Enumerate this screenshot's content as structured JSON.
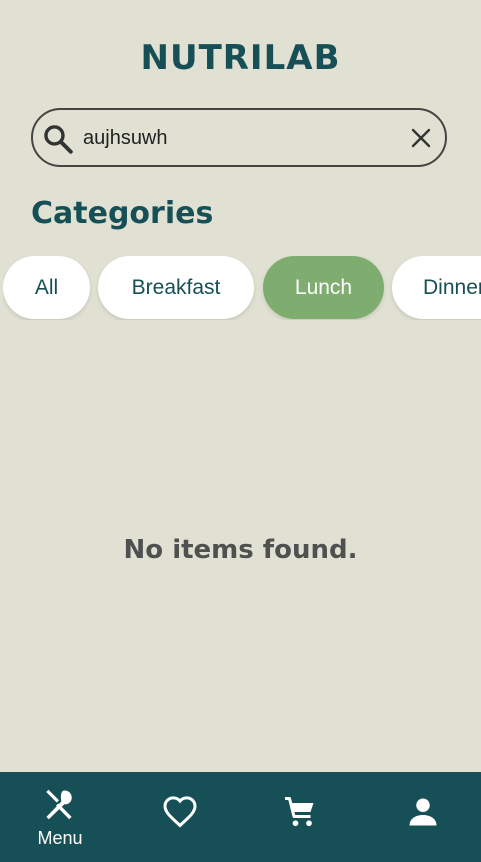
{
  "app": {
    "title": "NUTRILAB"
  },
  "search": {
    "value": "aujhsuwh"
  },
  "categories": {
    "heading": "Categories",
    "chips": [
      {
        "label": "All",
        "active": false
      },
      {
        "label": "Breakfast",
        "active": false
      },
      {
        "label": "Lunch",
        "active": true
      },
      {
        "label": "Dinner",
        "active": false
      }
    ]
  },
  "content": {
    "empty_message": "No items found."
  },
  "bottom_nav": {
    "items": [
      {
        "label": "Menu",
        "icon": "utensils-icon",
        "active": true
      },
      {
        "label": "",
        "icon": "heart-icon",
        "active": false
      },
      {
        "label": "",
        "icon": "cart-icon",
        "active": false
      },
      {
        "label": "",
        "icon": "person-icon",
        "active": false
      }
    ]
  },
  "colors": {
    "background": "#e1e1d3",
    "primary": "#174f57",
    "active_chip": "#7fad6f",
    "chip": "#ffffff"
  }
}
